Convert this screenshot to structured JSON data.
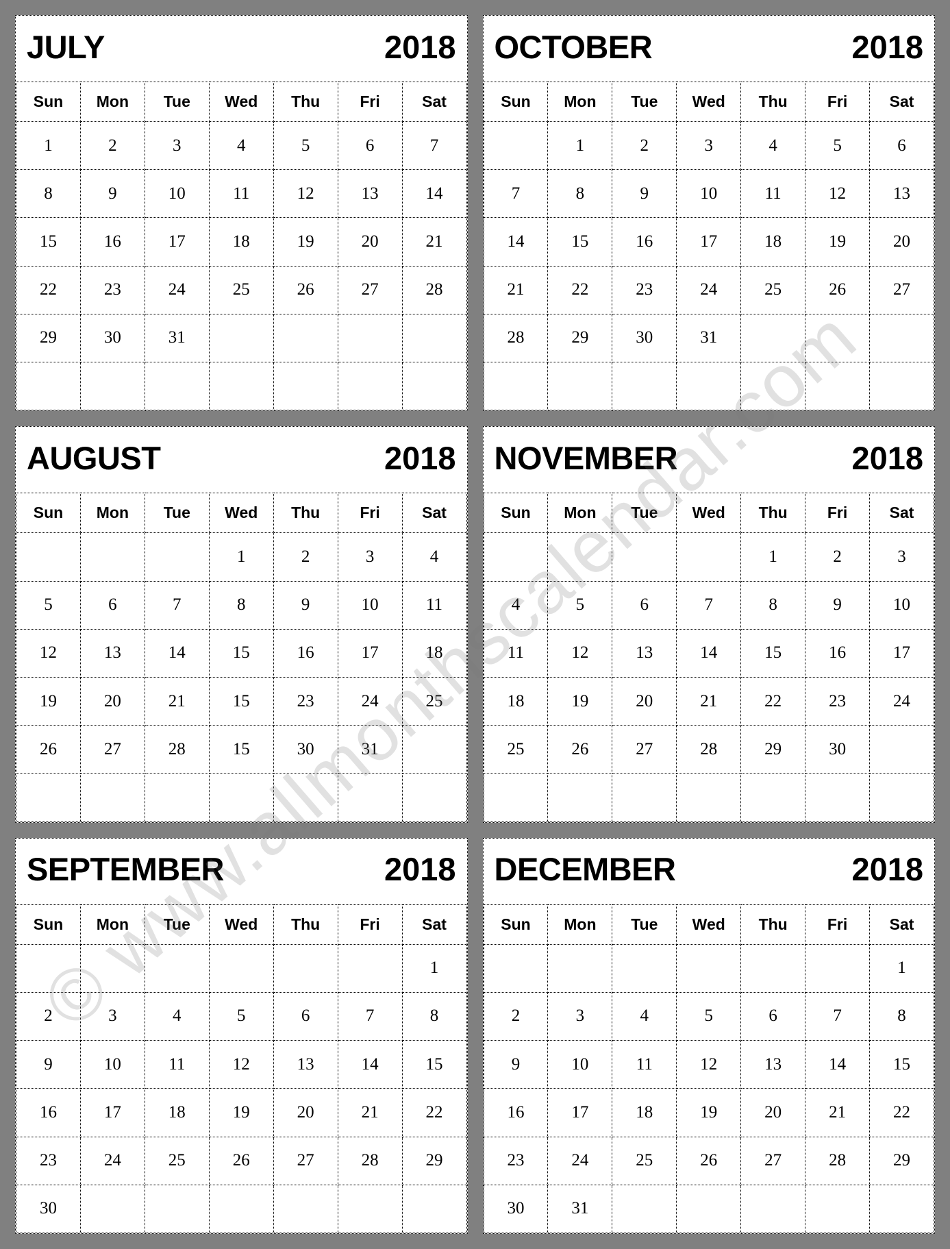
{
  "page": {
    "year": "2018",
    "background_color": "#808080",
    "card_color": "#ffffff",
    "text_color": "#000000"
  },
  "watermark": {
    "line1": "© www.allmonthscalendar.com",
    "color": "#787878"
  },
  "weekday_headers": [
    "Sun",
    "Mon",
    "Tue",
    "Wed",
    "Thu",
    "Fri",
    "Sat"
  ],
  "months": [
    {
      "name": "JULY",
      "year": "2018",
      "weeks": [
        [
          "1",
          "2",
          "3",
          "4",
          "5",
          "6",
          "7"
        ],
        [
          "8",
          "9",
          "10",
          "11",
          "12",
          "13",
          "14"
        ],
        [
          "15",
          "16",
          "17",
          "18",
          "19",
          "20",
          "21"
        ],
        [
          "22",
          "23",
          "24",
          "25",
          "26",
          "27",
          "28"
        ],
        [
          "29",
          "30",
          "31",
          "",
          "",
          "",
          ""
        ],
        [
          "",
          "",
          "",
          "",
          "",
          "",
          ""
        ]
      ]
    },
    {
      "name": "OCTOBER",
      "year": "2018",
      "weeks": [
        [
          "",
          "1",
          "2",
          "3",
          "4",
          "5",
          "6"
        ],
        [
          "7",
          "8",
          "9",
          "10",
          "11",
          "12",
          "13"
        ],
        [
          "14",
          "15",
          "16",
          "17",
          "18",
          "19",
          "20"
        ],
        [
          "21",
          "22",
          "23",
          "24",
          "25",
          "26",
          "27"
        ],
        [
          "28",
          "29",
          "30",
          "31",
          "",
          "",
          ""
        ],
        [
          "",
          "",
          "",
          "",
          "",
          "",
          ""
        ]
      ]
    },
    {
      "name": "AUGUST",
      "year": "2018",
      "weeks": [
        [
          "",
          "",
          "",
          "1",
          "2",
          "3",
          "4"
        ],
        [
          "5",
          "6",
          "7",
          "8",
          "9",
          "10",
          "11"
        ],
        [
          "12",
          "13",
          "14",
          "15",
          "16",
          "17",
          "18"
        ],
        [
          "19",
          "20",
          "21",
          "15",
          "23",
          "24",
          "25"
        ],
        [
          "26",
          "27",
          "28",
          "15",
          "30",
          "31",
          ""
        ],
        [
          "",
          "",
          "",
          "",
          "",
          "",
          ""
        ]
      ]
    },
    {
      "name": "NOVEMBER",
      "year": "2018",
      "weeks": [
        [
          "",
          "",
          "",
          "",
          "1",
          "2",
          "3"
        ],
        [
          "4",
          "5",
          "6",
          "7",
          "8",
          "9",
          "10"
        ],
        [
          "11",
          "12",
          "13",
          "14",
          "15",
          "16",
          "17"
        ],
        [
          "18",
          "19",
          "20",
          "21",
          "22",
          "23",
          "24"
        ],
        [
          "25",
          "26",
          "27",
          "28",
          "29",
          "30",
          ""
        ],
        [
          "",
          "",
          "",
          "",
          "",
          "",
          ""
        ]
      ]
    },
    {
      "name": "SEPTEMBER",
      "year": "2018",
      "weeks": [
        [
          "",
          "",
          "",
          "",
          "",
          "",
          "1"
        ],
        [
          "2",
          "3",
          "4",
          "5",
          "6",
          "7",
          "8"
        ],
        [
          "9",
          "10",
          "11",
          "12",
          "13",
          "14",
          "15"
        ],
        [
          "16",
          "17",
          "18",
          "19",
          "20",
          "21",
          "22"
        ],
        [
          "23",
          "24",
          "25",
          "26",
          "27",
          "28",
          "29"
        ],
        [
          "30",
          "",
          "",
          "",
          "",
          "",
          ""
        ]
      ]
    },
    {
      "name": "DECEMBER",
      "year": "2018",
      "weeks": [
        [
          "",
          "",
          "",
          "",
          "",
          "",
          "1"
        ],
        [
          "2",
          "3",
          "4",
          "5",
          "6",
          "7",
          "8"
        ],
        [
          "9",
          "10",
          "11",
          "12",
          "13",
          "14",
          "15"
        ],
        [
          "16",
          "17",
          "18",
          "19",
          "20",
          "21",
          "22"
        ],
        [
          "23",
          "24",
          "25",
          "26",
          "27",
          "28",
          "29"
        ],
        [
          "30",
          "31",
          "",
          "",
          "",
          "",
          ""
        ]
      ]
    }
  ]
}
